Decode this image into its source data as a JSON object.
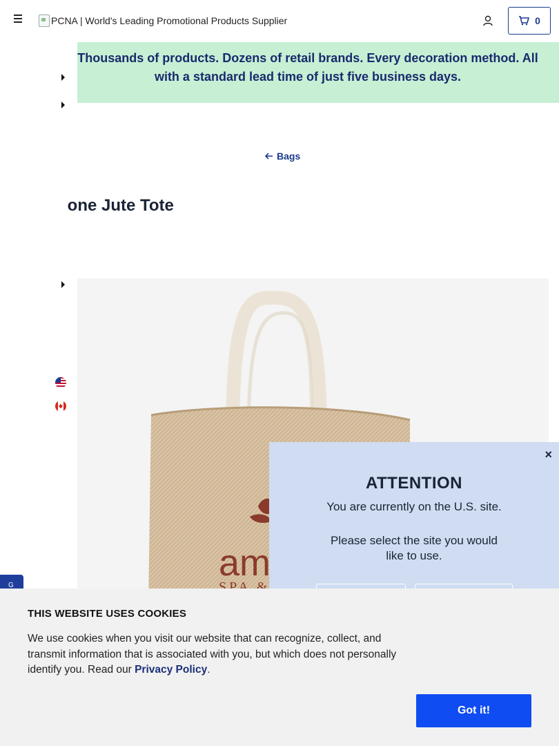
{
  "header": {
    "logo_alt": "PCNA | World's Leading Promotional Products Supplier",
    "cart_count": "0"
  },
  "banner": {
    "text_line1": "Thousands of products. Dozens of retail brands. Every decoration method. All",
    "text_line2": "with a standard lead time of just five business days."
  },
  "breadcrumb": {
    "label": "Bags"
  },
  "product": {
    "title": "Boone Jute Tote",
    "visible_title": "oone Jute Tote",
    "print_text_1": "am",
    "print_text_2": "SPA &"
  },
  "attention": {
    "title": "ATTENTION",
    "line1": "You are currently on the U.S. site.",
    "line2": "Please select the site you would like to use.",
    "close_label": "×"
  },
  "cookie": {
    "title": "THIS WEBSITE USES COOKIES",
    "text": "We use cookies when you visit our website that can recognize, collect, and transmit information that is associated with you, but which does not personally identify you. Read our ",
    "link_label": "Privacy Policy",
    "period": ".",
    "button_label": "Got it!"
  },
  "feedback": {
    "label": "G"
  },
  "colors": {
    "brand_blue": "#1a3a8f",
    "banner_green": "#c6efd4",
    "attention_bg": "#cfdcf2",
    "cookie_button": "#0f4cf2"
  }
}
